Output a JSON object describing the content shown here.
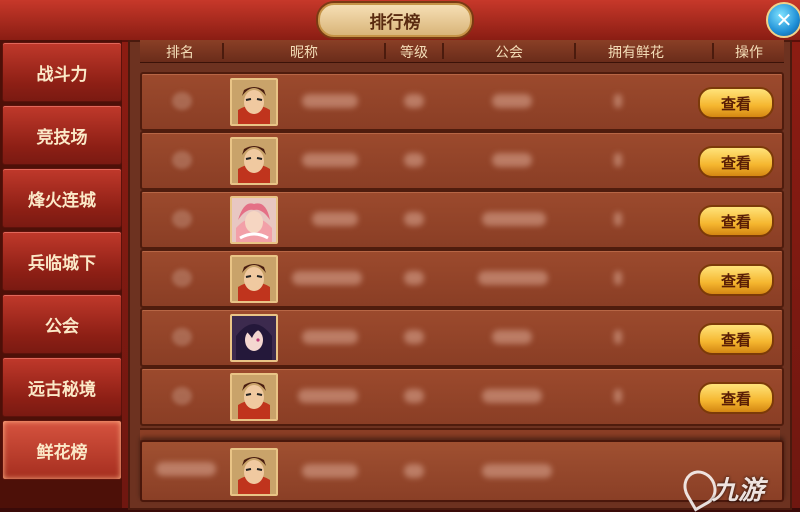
{
  "window": {
    "title": "排行榜",
    "close_icon": "close-x-icon"
  },
  "sidebar": {
    "items": [
      {
        "label": "战斗力",
        "active": false
      },
      {
        "label": "竞技场",
        "active": false
      },
      {
        "label": "烽火连城",
        "active": false
      },
      {
        "label": "兵临城下",
        "active": false
      },
      {
        "label": "公会",
        "active": false
      },
      {
        "label": "远古秘境",
        "active": false
      },
      {
        "label": "鲜花榜",
        "active": true
      }
    ]
  },
  "table": {
    "headers": [
      "排名",
      "昵称",
      "等级",
      "公会",
      "拥有鲜花",
      "操作"
    ],
    "rows": [
      {
        "avatar": "male-warrior-portrait",
        "action": "查看"
      },
      {
        "avatar": "male-warrior-portrait",
        "action": "查看"
      },
      {
        "avatar": "pink-hair-portrait",
        "action": "查看"
      },
      {
        "avatar": "male-warrior-portrait",
        "action": "查看"
      },
      {
        "avatar": "dark-hair-female-portrait",
        "action": "查看"
      },
      {
        "avatar": "male-warrior-portrait",
        "action": "查看"
      }
    ],
    "self_row": {
      "avatar": "male-warrior-portrait"
    }
  },
  "watermark": {
    "text": "九游"
  }
}
